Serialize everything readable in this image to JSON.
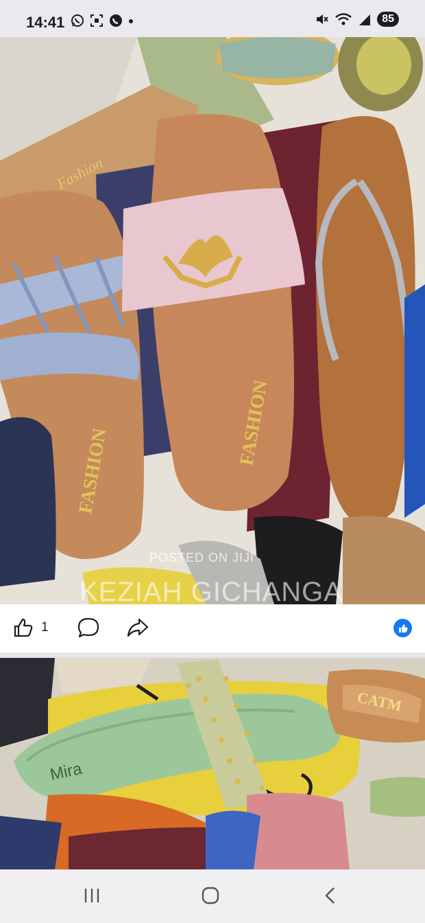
{
  "status_bar": {
    "time": "14:41",
    "battery": "85",
    "left_icons": [
      "whatsapp-icon",
      "screenshot-icon",
      "phone-call-icon",
      "dot-icon"
    ],
    "right_icons": [
      "mute-icon",
      "wifi-icon",
      "signal-icon"
    ]
  },
  "post_image_1": {
    "sandal_prints": [
      "FASHION",
      "FASHION",
      "Fashion"
    ],
    "watermark_posted": "POSTED ON JIJI",
    "watermark_name": "KEZIAH GICHANGA"
  },
  "actions": {
    "like_count": "1",
    "like_icon": "thumbs-up-icon",
    "comment_icon": "comment-icon",
    "share_icon": "share-icon",
    "reaction_icon": "like-reaction-icon",
    "accent_color": "#1877f2"
  },
  "post_image_2": {
    "sandal_prints": [
      "Mira",
      "CATM"
    ]
  },
  "nav_bar": {
    "buttons": [
      "recent-apps",
      "home",
      "back"
    ]
  }
}
